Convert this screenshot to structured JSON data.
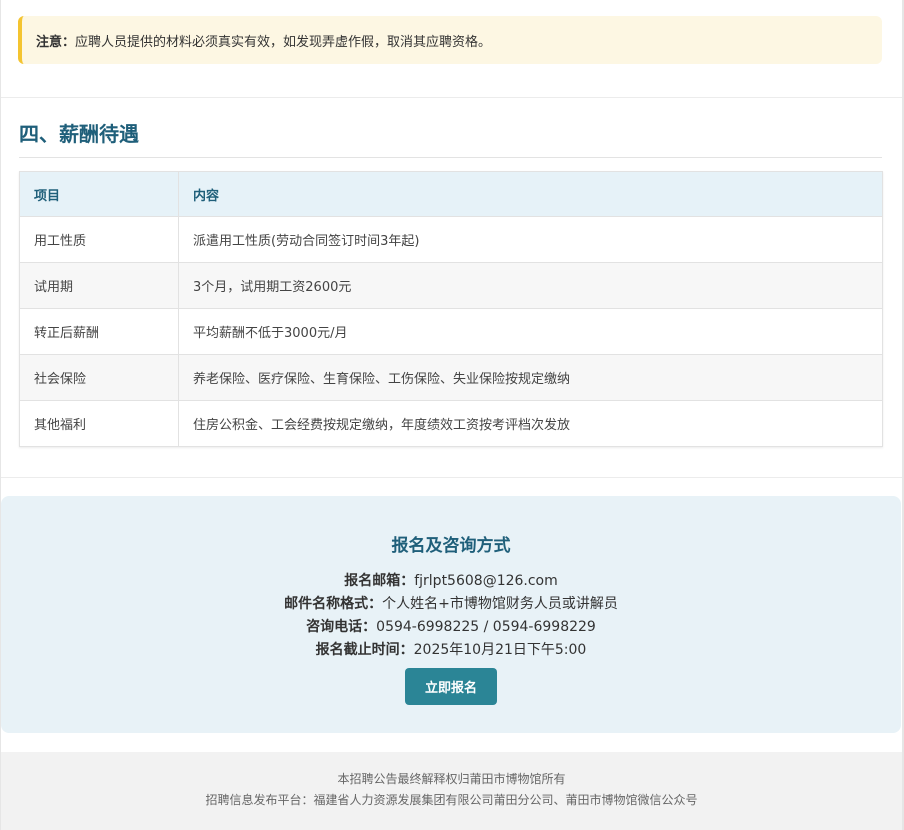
{
  "notice": {
    "label": "注意：",
    "text": "应聘人员提供的材料必须真实有效，如发现弄虚作假，取消其应聘资格。"
  },
  "salary_section": {
    "title": "四、薪酬待遇",
    "headers": [
      "项目",
      "内容"
    ],
    "rows": [
      [
        "用工性质",
        "派遣用工性质(劳动合同签订时间3年起)"
      ],
      [
        "试用期",
        "3个月，试用期工资2600元"
      ],
      [
        "转正后薪酬",
        "平均薪酬不低于3000元/月"
      ],
      [
        "社会保险",
        "养老保险、医疗保险、生育保险、工伤保险、失业保险按规定缴纳"
      ],
      [
        "其他福利",
        "住房公积金、工会经费按规定缴纳，年度绩效工资按考评档次发放"
      ]
    ]
  },
  "contact": {
    "title": "报名及咨询方式",
    "email_label": "报名邮箱：",
    "email_value": "fjrlpt5608@126.com",
    "format_label": "邮件名称格式：",
    "format_value": "个人姓名+市博物馆财务人员或讲解员",
    "phone_label": "咨询电话：",
    "phone_value": "0594-6998225 / 0594-6998229",
    "deadline_label": "报名截止时间：",
    "deadline_value": "2025年10月21日下午5:00",
    "apply_button": "立即报名"
  },
  "footer": {
    "line1": "本招聘公告最终解释权归莆田市博物馆所有",
    "line2": "招聘信息发布平台：福建省人力资源发展集团有限公司莆田分公司、莆田市博物馆微信公众号"
  },
  "colors": {
    "accent": "#1f5f7a",
    "button": "#2b8596",
    "notice_bg": "#fdf7e3",
    "notice_border": "#f4c430",
    "contact_bg": "#e8f2f7"
  }
}
